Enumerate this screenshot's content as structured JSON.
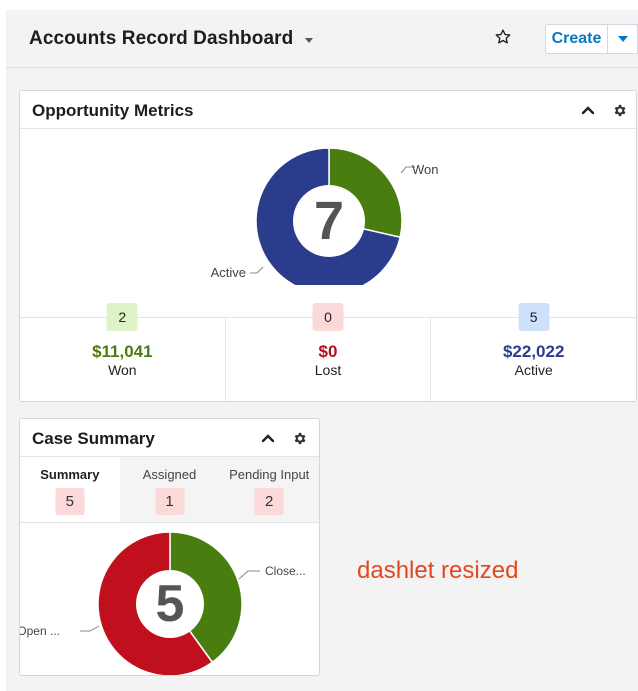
{
  "header": {
    "title": "Accounts Record Dashboard",
    "create_label": "Create",
    "icons": {
      "favorite": "star-icon",
      "title_menu": "chevron-down-icon",
      "create_menu": "chevron-down-icon"
    }
  },
  "opportunity": {
    "title": "Opportunity Metrics",
    "icons": {
      "collapse": "chevron-up-icon",
      "settings": "gear-icon"
    },
    "chart": {
      "total": "7",
      "won_label": "Won",
      "active_label": "Active"
    },
    "metrics": [
      {
        "count": "2",
        "amount": "$11,041",
        "label": "Won",
        "color": "#4a7d0f",
        "badge_bg": "#dff3c9"
      },
      {
        "count": "0",
        "amount": "$0",
        "label": "Lost",
        "color": "#b0101d",
        "badge_bg": "#fcd9d9"
      },
      {
        "count": "5",
        "amount": "$22,022",
        "label": "Active",
        "color": "#2c3c8d",
        "badge_bg": "#cfe0fa"
      }
    ]
  },
  "case_summary": {
    "title": "Case Summary",
    "icons": {
      "collapse": "chevron-up-icon",
      "settings": "gear-icon"
    },
    "tabs": [
      {
        "label": "Summary",
        "count": "5"
      },
      {
        "label": "Assigned",
        "count": "1"
      },
      {
        "label": "Pending Input",
        "count": "2"
      }
    ],
    "chart": {
      "total": "5",
      "closed_label": "Close...",
      "open_label": "Open ..."
    }
  },
  "note": "dashlet resized",
  "colors": {
    "won": "#4a7d0f",
    "active": "#2c3c8d",
    "lost": "#b0101d",
    "open": "#c0101e",
    "closed": "#4a7d0f",
    "accent": "#0b77c4"
  },
  "chart_data": [
    {
      "type": "pie",
      "categories": [
        "Won",
        "Active"
      ],
      "values": [
        2,
        5
      ]
    },
    {
      "type": "pie",
      "categories": [
        "Close...",
        "Open ..."
      ],
      "values": [
        2,
        3
      ]
    }
  ]
}
